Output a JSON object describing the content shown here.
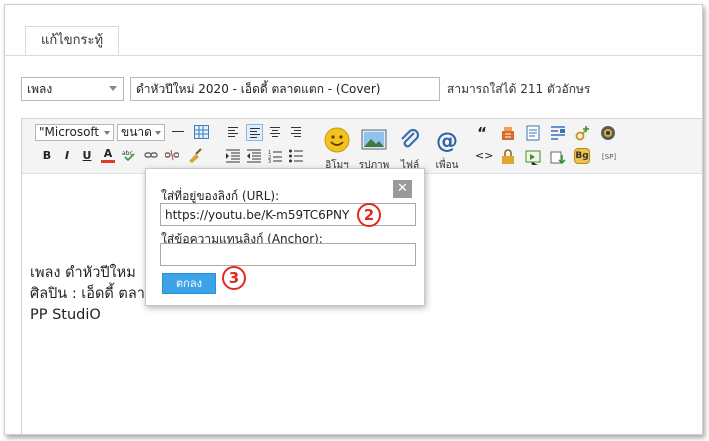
{
  "tab": {
    "label": "แก้ไขกระทู้"
  },
  "title_row": {
    "category_value": "เพลง",
    "title_value": "ดำหัวปีใหม่ 2020 - เอ็ดดี้ ตลาดแตก - (Cover)",
    "counter_text": "สามารถใส่ได้ 211 ตัวอักษร"
  },
  "toolbar": {
    "font_value": "\"Microsoft",
    "size_value": "ขนาด",
    "bold": "B",
    "italic": "I",
    "underline": "U",
    "font_color": "A",
    "emoji_label": "อิโมฯ",
    "image_label": "รูปภาพ",
    "file_label": "ไฟล์",
    "friend_label": "เพื่อน",
    "quote_glyph": "“",
    "code_glyph": "<>",
    "bg_label": "Bg",
    "sp_label": "[SP]"
  },
  "content": {
    "lines": [
      "เพลง    ดำหัวปีใหม",
      "ศิลปิน : เอ็ดดี้ ตลา",
      "PP StudiO"
    ]
  },
  "link_dialog": {
    "url_label": "ใส่ที่อยู่ของลิงก์ (URL):",
    "url_value": "https://youtu.be/K-m59TC6PNY",
    "anchor_label": "ใส่ข้อความแทนลิงก์ (Anchor):",
    "anchor_value": "",
    "ok_label": "ตกลง",
    "close_glyph": "✕"
  },
  "annotations": {
    "step_2": "2",
    "step_3": "3"
  },
  "colors": {
    "accent": "#3da3e8",
    "marker": "#e12a1f"
  }
}
